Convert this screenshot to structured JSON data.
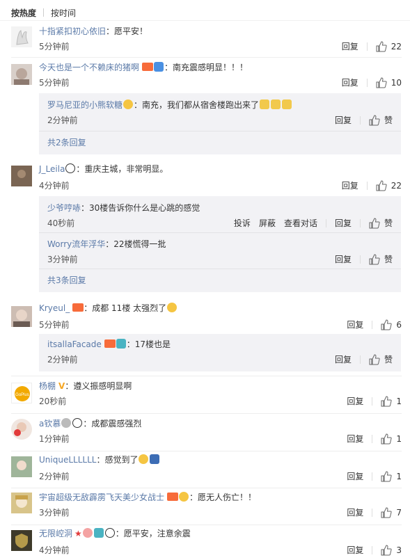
{
  "sort": {
    "hot": "按热度",
    "time": "按时间"
  },
  "labels": {
    "reply": "回复",
    "like": "赞",
    "report": "投诉",
    "block": "屏蔽",
    "view_thread": "查看对话"
  },
  "comments": [
    {
      "user": "十指紧扣初心依旧",
      "text": "：愿平安！",
      "time": "5分钟前",
      "likes": "22"
    },
    {
      "user": "今天也是一个不赖床的猪啊",
      "text": "：南充震感明显！！！",
      "time": "5分钟前",
      "likes": "10",
      "replies": [
        {
          "user": "罗马尼亚的小熊软糖",
          "text": "：南充，我们都从宿舍楼跑出来了",
          "time": "2分钟前"
        }
      ],
      "more": "共2条回复"
    },
    {
      "user": "J_Leila",
      "text": "：重庆主城，非常明显。",
      "time": "4分钟前",
      "likes": "22",
      "replies": [
        {
          "user": "少爷哼哧",
          "text": "：30楼告诉你什么是心跳的感觉",
          "time": "40秒前"
        },
        {
          "user": "Worry流年浮华",
          "text": "：22楼慌得一批",
          "time": "3分钟前"
        }
      ],
      "more": "共3条回复"
    },
    {
      "user": "Kryeul_",
      "text": "：成都 11楼 太强烈了",
      "time": "5分钟前",
      "likes": "6",
      "replies": [
        {
          "user": "itsallaFacade",
          "text": "：17楼也是",
          "time": "2分钟前"
        }
      ]
    },
    {
      "user": "杨棚",
      "text": "：遵义振感明显啊",
      "time": "20秒前",
      "likes": "1",
      "avatar_text": "GoPlus"
    },
    {
      "user": "a钦慕",
      "text": "：成都震感强烈",
      "time": "1分钟前",
      "likes": "1"
    },
    {
      "user": "UniqueLLLLLL",
      "text": "：感觉到了",
      "time": "2分钟前",
      "likes": "1"
    },
    {
      "user": "宇宙超级无敌霹雳飞天美少女战士",
      "text": "：愿无人伤亡！！",
      "time": "3分钟前",
      "likes": "7"
    },
    {
      "user": "无限崆洞",
      "text": "：愿平安，注意余震",
      "time": "4分钟前",
      "likes": "3"
    }
  ]
}
